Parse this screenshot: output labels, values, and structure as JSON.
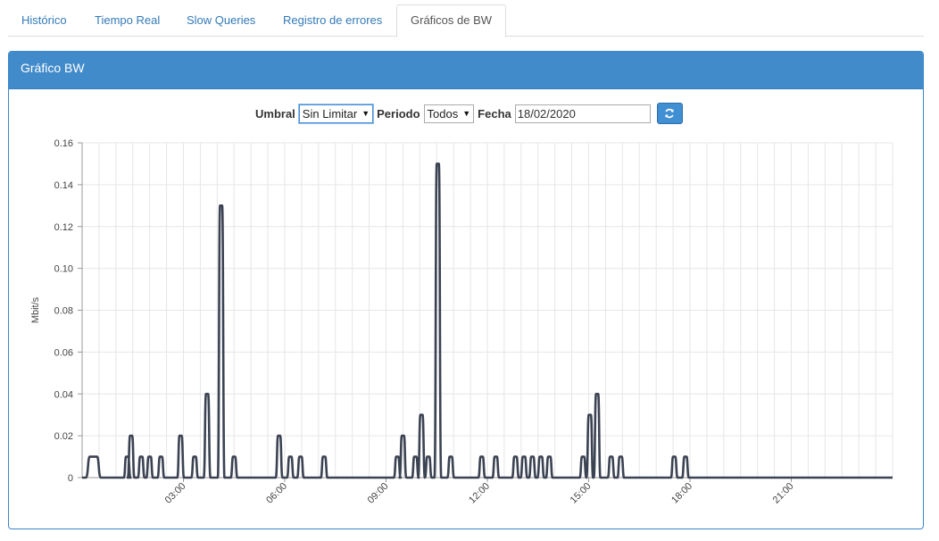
{
  "tabs": [
    {
      "label": "Histórico",
      "active": false
    },
    {
      "label": "Tiempo Real",
      "active": false
    },
    {
      "label": "Slow Queries",
      "active": false
    },
    {
      "label": "Registro de errores",
      "active": false
    },
    {
      "label": "Gráficos de BW",
      "active": true
    }
  ],
  "panel": {
    "title": "Gráfico BW"
  },
  "controls": {
    "umbral_label": "Umbral",
    "umbral_value": "Sin Limitar",
    "periodo_label": "Periodo",
    "periodo_value": "Todos",
    "fecha_label": "Fecha",
    "fecha_value": "18/02/2020",
    "refresh_icon": "refresh-icon"
  },
  "colors": {
    "accent": "#428bca",
    "line": "#3b4252",
    "grid": "#e6e6e6"
  },
  "chart_data": {
    "type": "line",
    "ylabel": "Mbit/s",
    "ylim": [
      0,
      0.16
    ],
    "yticks": [
      "0",
      "0.02",
      "0.04",
      "0.06",
      "0.08",
      "0.10",
      "0.12",
      "0.14",
      "0.16"
    ],
    "xlim_hours": [
      0,
      24
    ],
    "xticks": [
      "03:00",
      "06:00",
      "09:00",
      "12:00",
      "15:00",
      "18:00",
      "21:00"
    ],
    "grid": true,
    "series": [
      {
        "peaks": [
          {
            "t": "00:20",
            "v": 0.01,
            "w": "wide"
          },
          {
            "t": "01:20",
            "v": 0.01
          },
          {
            "t": "01:27",
            "v": 0.02
          },
          {
            "t": "01:45",
            "v": 0.01
          },
          {
            "t": "02:00",
            "v": 0.01
          },
          {
            "t": "02:20",
            "v": 0.01
          },
          {
            "t": "02:55",
            "v": 0.02
          },
          {
            "t": "03:20",
            "v": 0.01
          },
          {
            "t": "03:42",
            "v": 0.04
          },
          {
            "t": "04:07",
            "v": 0.13
          },
          {
            "t": "04:30",
            "v": 0.01
          },
          {
            "t": "05:50",
            "v": 0.02
          },
          {
            "t": "06:10",
            "v": 0.01
          },
          {
            "t": "06:28",
            "v": 0.01
          },
          {
            "t": "07:10",
            "v": 0.01
          },
          {
            "t": "09:20",
            "v": 0.01
          },
          {
            "t": "09:30",
            "v": 0.02
          },
          {
            "t": "09:52",
            "v": 0.01
          },
          {
            "t": "10:03",
            "v": 0.03
          },
          {
            "t": "10:15",
            "v": 0.01
          },
          {
            "t": "10:32",
            "v": 0.15
          },
          {
            "t": "10:55",
            "v": 0.01
          },
          {
            "t": "11:50",
            "v": 0.01
          },
          {
            "t": "12:15",
            "v": 0.01
          },
          {
            "t": "12:50",
            "v": 0.01
          },
          {
            "t": "13:05",
            "v": 0.01
          },
          {
            "t": "13:20",
            "v": 0.01
          },
          {
            "t": "13:35",
            "v": 0.01
          },
          {
            "t": "13:50",
            "v": 0.01
          },
          {
            "t": "14:50",
            "v": 0.01
          },
          {
            "t": "15:02",
            "v": 0.03
          },
          {
            "t": "15:15",
            "v": 0.04
          },
          {
            "t": "15:40",
            "v": 0.01
          },
          {
            "t": "15:57",
            "v": 0.01
          },
          {
            "t": "17:32",
            "v": 0.01
          },
          {
            "t": "17:52",
            "v": 0.01
          }
        ]
      }
    ]
  }
}
